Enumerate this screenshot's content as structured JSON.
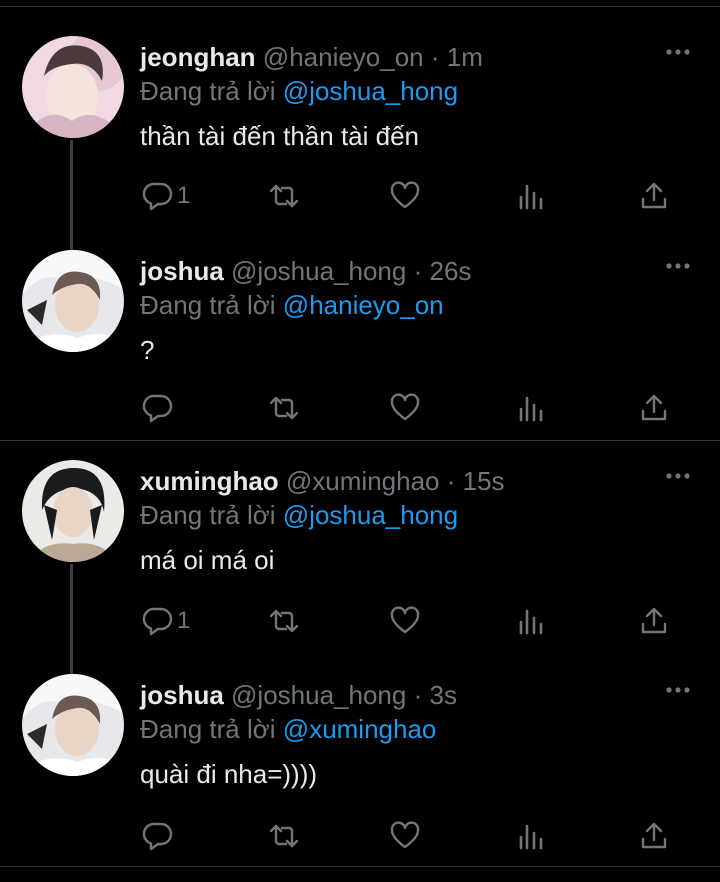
{
  "reply_prefix": "Đang trả lời",
  "tweets": [
    {
      "name": "jeonghan",
      "handle": "@hanieyo_on",
      "time": "1m",
      "reply_to": "@joshua_hong",
      "text": "thần tài đến thần tài đến",
      "replies": "1",
      "avatar": "avatar-jeonghan"
    },
    {
      "name": "joshua",
      "handle": "@joshua_hong",
      "time": "26s",
      "reply_to": "@hanieyo_on",
      "text": "?",
      "replies": "",
      "avatar": "avatar-joshua"
    },
    {
      "name": "xuminghao",
      "handle": "@xuminghao",
      "time": "15s",
      "reply_to": "@joshua_hong",
      "text": "má oi má oi",
      "replies": "1",
      "avatar": "avatar-xuminghao"
    },
    {
      "name": "joshua",
      "handle": "@joshua_hong",
      "time": "3s",
      "reply_to": "@xuminghao",
      "text": "quài đi nha=))))",
      "replies": "",
      "avatar": "avatar-joshua"
    }
  ],
  "icons": [
    "reply-icon",
    "retweet-icon",
    "like-icon",
    "analytics-icon",
    "share-icon",
    "more-icon"
  ],
  "colors": {
    "background": "#000000",
    "text": "#e7e9ea",
    "secondary": "#71767b",
    "accent": "#1d9bf0",
    "divider": "#2f3336"
  }
}
